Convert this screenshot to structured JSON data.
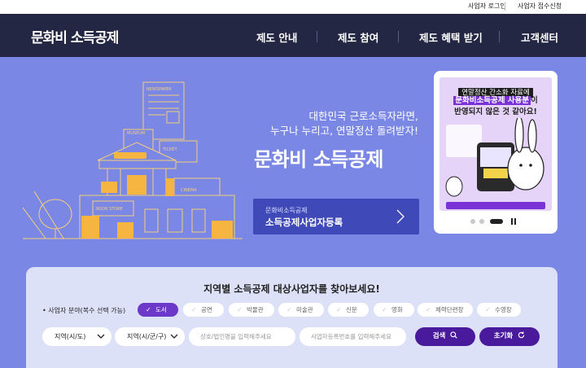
{
  "util": {
    "login": "사업자 로그인",
    "apply": "사업자 접수신청"
  },
  "header": {
    "logo": "문화비 소득공제",
    "nav": [
      "제도 안내",
      "제도 참여",
      "제도 혜택 받기",
      "고객센터"
    ]
  },
  "hero": {
    "sub1": "대한민국 근로소득자라면,",
    "sub2": "누구나 누리고, 연말정산 돌려받자!",
    "title": "문화비 소득공제",
    "cta_small": "문화비소득공제",
    "cta_big": "소득공제사업자등록",
    "illustration_labels": {
      "newspaper": "NEWSPAPER",
      "museum": "MUSEUM",
      "ticket": "TICKET",
      "cinema": "CINEMA",
      "bookstore": "BOOK STORE"
    }
  },
  "banner": {
    "line1": "연말정산 간소화 자료에",
    "line2_highlight": "문화비소득공제 사용분",
    "line2_rest": "이",
    "line3": "반영되지 않은 것 같아요!"
  },
  "search": {
    "title": "지역별 소득공제 대상사업자를 찾아보세요!",
    "filter_label": "• 사업자 분야(복수 선택 가능)",
    "chips": [
      {
        "label": "도서",
        "active": true
      },
      {
        "label": "공연",
        "active": false
      },
      {
        "label": "박물관",
        "active": false
      },
      {
        "label": "미술관",
        "active": false
      },
      {
        "label": "신문",
        "active": false
      },
      {
        "label": "영화",
        "active": false
      },
      {
        "label": "체력단련장",
        "active": false
      },
      {
        "label": "수영장",
        "active": false
      }
    ],
    "select_sido": "지역(시/도)",
    "select_sigungu": "지역(시/군/구)",
    "placeholder_name": "상호/법인명을 입력해주세요",
    "placeholder_bizno": "사업자등록번호를 입력해주세요",
    "search_button": "검색",
    "reset_button": "초기화"
  },
  "colors": {
    "header_bg": "#232743",
    "hero_bg": "#7b87e5",
    "accent": "#6c38c9",
    "button": "#4a1a9c",
    "illustration": "#f6b441"
  }
}
